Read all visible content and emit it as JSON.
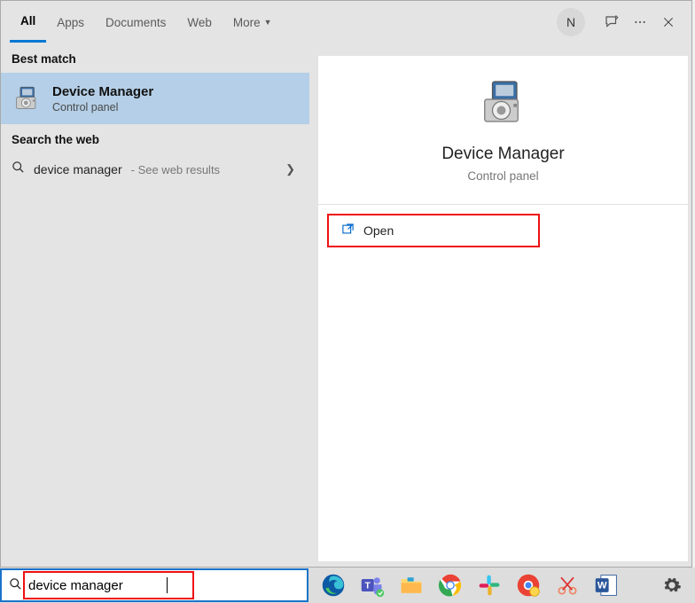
{
  "tabs": {
    "all": "All",
    "apps": "Apps",
    "documents": "Documents",
    "web": "Web",
    "more": "More"
  },
  "header": {
    "avatar_letter": "N"
  },
  "left": {
    "best_match_header": "Best match",
    "best_match": {
      "title": "Device Manager",
      "subtitle": "Control panel"
    },
    "web_header": "Search the web",
    "web_query": "device manager",
    "web_hint": "- See web results"
  },
  "preview": {
    "title": "Device Manager",
    "subtitle": "Control panel",
    "open": "Open"
  },
  "search": {
    "value": "device manager"
  }
}
